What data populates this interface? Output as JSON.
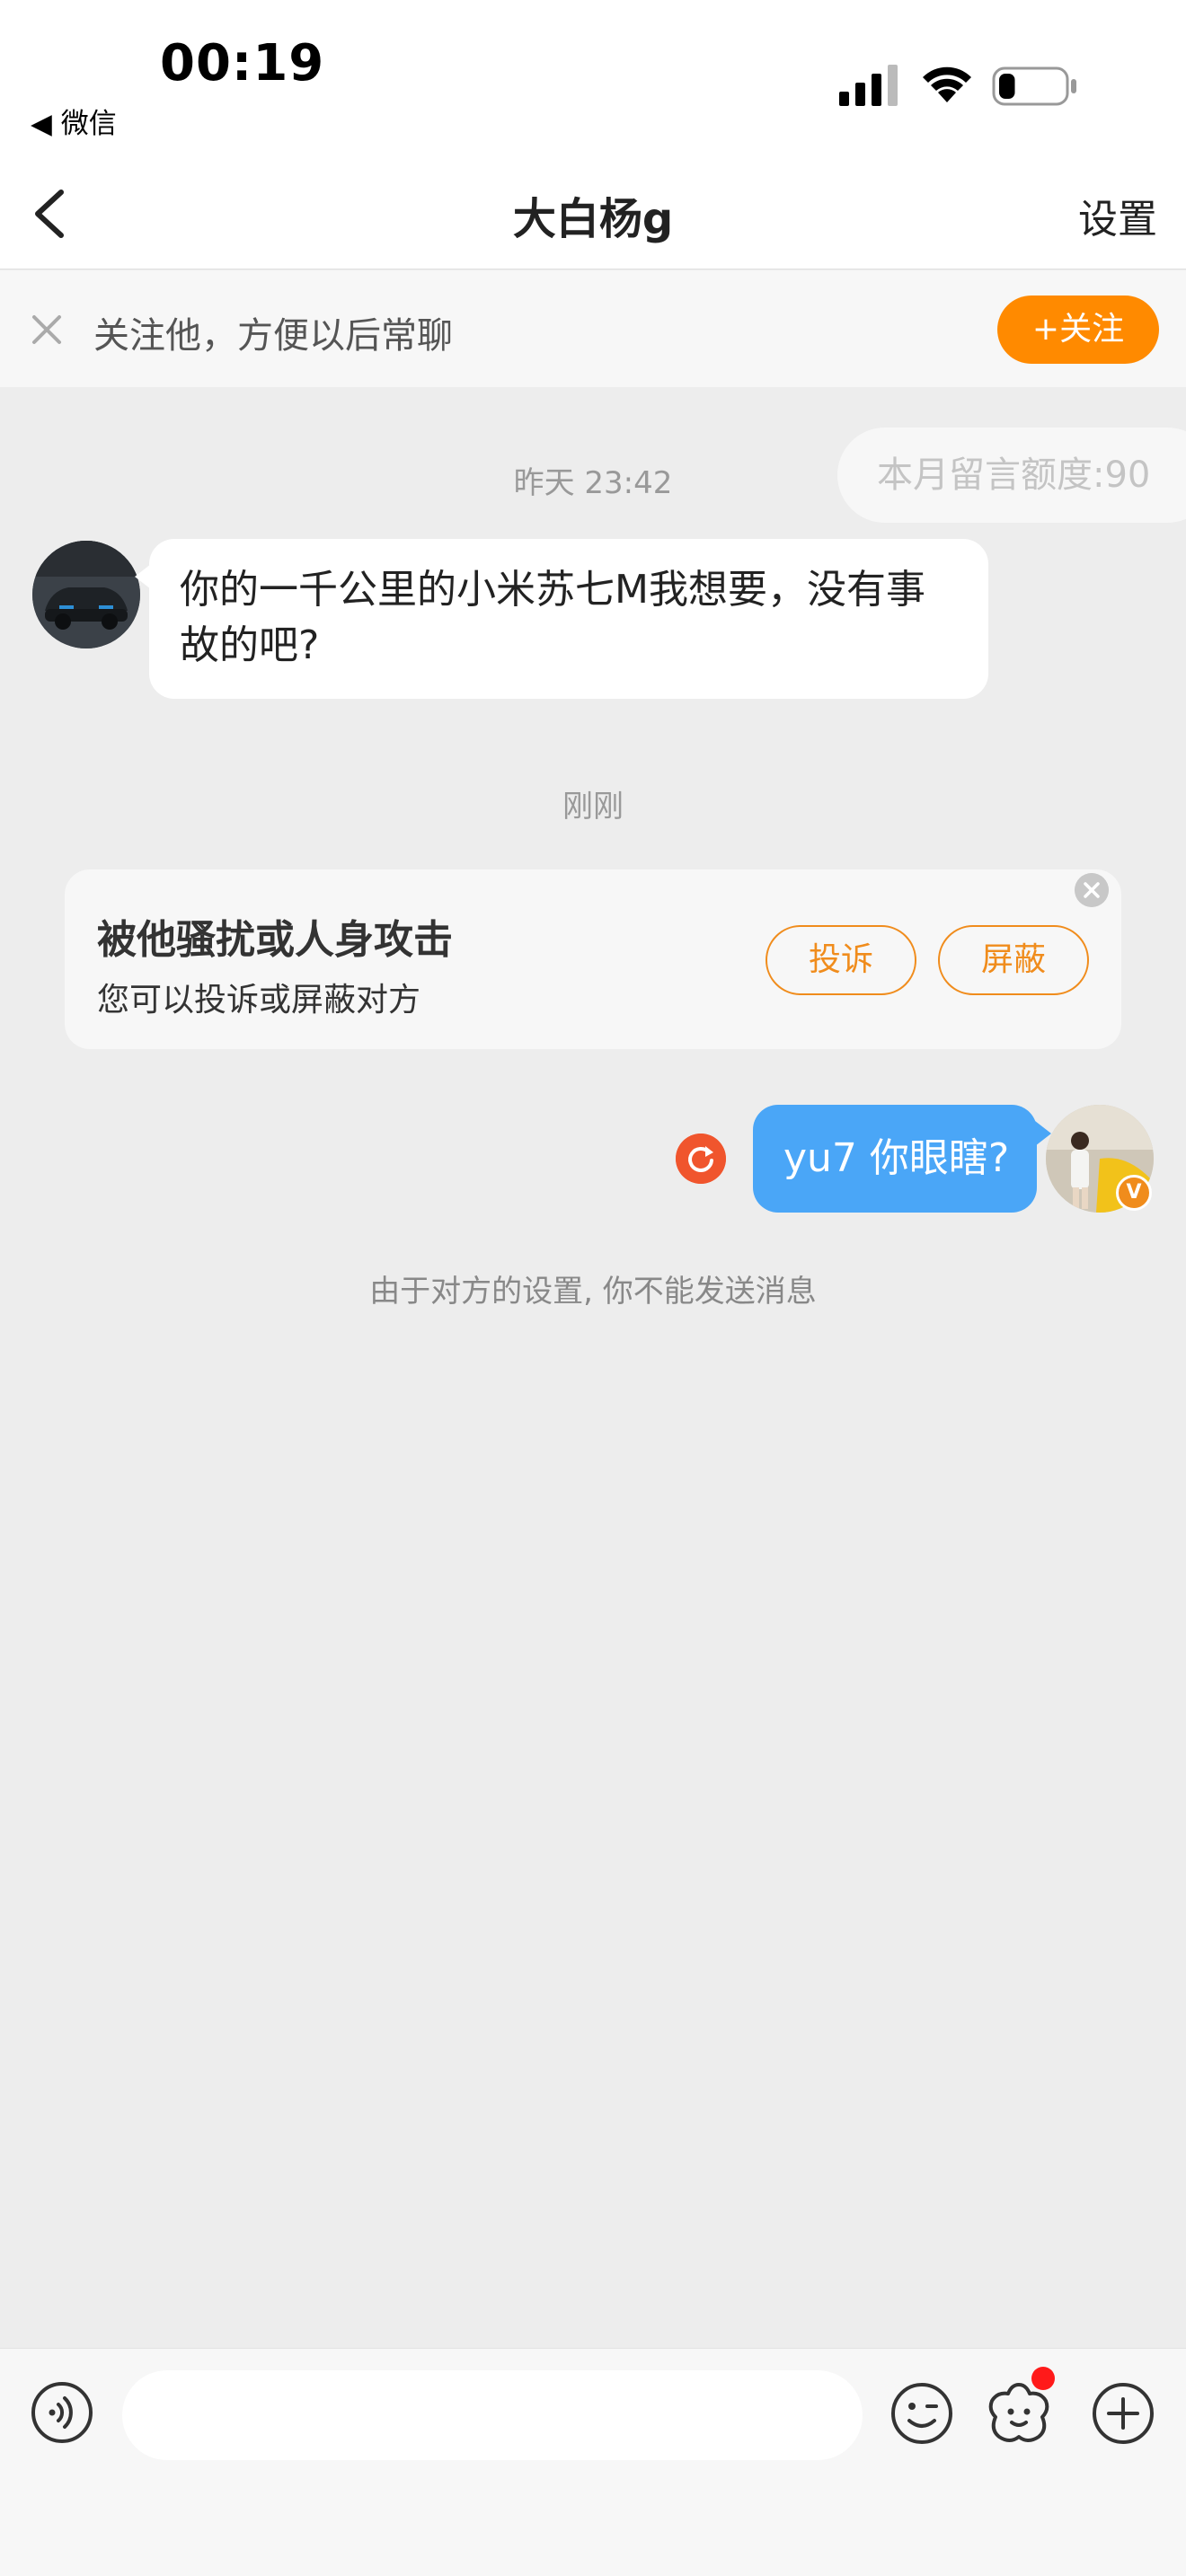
{
  "status_bar": {
    "time": "00:19",
    "back_app_label": "◀ 微信",
    "battery_level": 0.25
  },
  "nav": {
    "title": "大白杨g",
    "settings_label": "设置"
  },
  "follow_bar": {
    "text": "关注他，方便以后常聊",
    "follow_button_label": "+关注"
  },
  "quota_pill": "本月留言额度:90",
  "messages": {
    "time_1": "昨天 23:42",
    "incoming_text": "你的一千公里的小米苏七M我想要，没有事故的吧?",
    "time_2": "刚刚",
    "outgoing_text": "yu7 你眼瞎?",
    "system_note": "由于对方的设置, 你不能发送消息"
  },
  "harass_card": {
    "title": "被他骚扰或人身攻击",
    "subtitle": "您可以投诉或屏蔽对方",
    "report_label": "投诉",
    "block_label": "屏蔽"
  },
  "badges": {
    "verified": "V"
  },
  "input_bar": {
    "placeholder": "",
    "icons": [
      "voice-icon",
      "emoji-icon",
      "sticker-icon",
      "plus-icon"
    ]
  },
  "colors": {
    "accent_orange": "#ff8a00",
    "bubble_blue": "#4aa6f7",
    "error_red": "#f0552d"
  }
}
